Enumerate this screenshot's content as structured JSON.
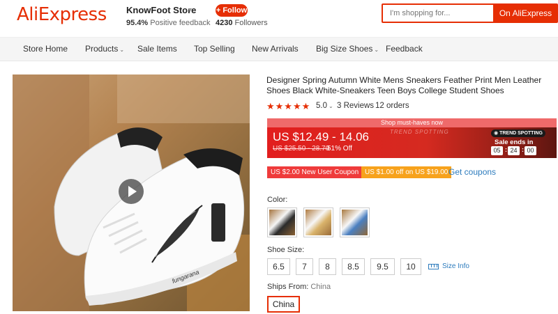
{
  "header": {
    "logo": "AliExpress",
    "store_name": "KnowFoot Store",
    "feedback_pct": "95.4%",
    "feedback_label": "Positive feedback",
    "follow_label": "+ Follow",
    "followers_count": "4230",
    "followers_label": "Followers",
    "search_placeholder": "I'm shopping for...",
    "search_button": "On AliExpress"
  },
  "nav": {
    "items": [
      {
        "label": "Store Home"
      },
      {
        "label": "Products"
      },
      {
        "label": "Sale Items"
      },
      {
        "label": "Top Selling"
      },
      {
        "label": "New Arrivals"
      },
      {
        "label": "Big Size Shoes"
      },
      {
        "label": "Feedback"
      }
    ]
  },
  "product": {
    "title": "Designer Spring Autumn White Mens Sneakers Feather Print Men Leather Shoes Black White-Sneakers Teen Boys College Student Shoes",
    "shoe_text": "fungarana",
    "rating": "5.0",
    "reviews": "3 Reviews",
    "orders": "12 orders",
    "rating_stars": 5
  },
  "promo": {
    "banner_top": "Shop must-haves now",
    "deco_text": "TREND SPOTTING",
    "price": "US $12.49 - 14.06",
    "old_price": "US $25.50 - 28.70",
    "off": "51% Off",
    "trend_badge": "TREND SPOTTING",
    "sale_ends_label": "Sale ends in",
    "countdown": {
      "hours": "05",
      "minutes": "24",
      "seconds": "00"
    }
  },
  "coupons": {
    "new_user": "US $2.00 New User Coupon",
    "off_coupon": "US $1.00 off on US $19.00",
    "get_coupons": "Get coupons"
  },
  "color": {
    "label": "Color:",
    "options": [
      "black-white",
      "white-gold",
      "white-blue"
    ]
  },
  "size": {
    "label": "Shoe Size:",
    "options": [
      "6.5",
      "7",
      "8",
      "8.5",
      "9.5",
      "10"
    ],
    "size_info": "Size Info"
  },
  "shipping": {
    "label": "Ships From:",
    "value": "China",
    "selected": "China"
  },
  "colors": {
    "accent": "#e62e04",
    "link": "#2c7bbd",
    "coupon_red": "#ef3b3b",
    "coupon_orange": "#f7a21c"
  }
}
